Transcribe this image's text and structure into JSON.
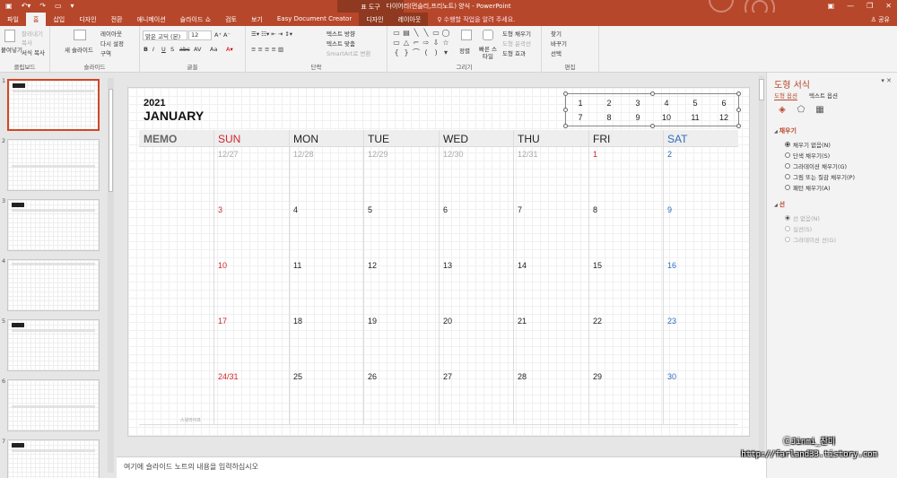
{
  "window": {
    "title": "다이어리(먼슬리,프리노트) 양식 - PowerPoint",
    "context_tab": "표 도구",
    "qat": [
      "save",
      "undo",
      "redo",
      "present"
    ]
  },
  "tabs": [
    {
      "label": "파일"
    },
    {
      "label": "홈",
      "active": true
    },
    {
      "label": "삽입"
    },
    {
      "label": "디자인"
    },
    {
      "label": "전환"
    },
    {
      "label": "애니메이션"
    },
    {
      "label": "슬라이드 쇼"
    },
    {
      "label": "검토"
    },
    {
      "label": "보기"
    },
    {
      "label": "Easy Document Creator"
    },
    {
      "label": "디자인",
      "contextual": true
    },
    {
      "label": "레이아웃"
    }
  ],
  "tell_me": "수행할 작업을 알려 주세요.",
  "share": "공유",
  "ribbon": {
    "clipboard": {
      "paste": "붙여넣기",
      "cut": "잘라내기",
      "copy": "복사",
      "format_painter": "서식 복사",
      "label": "클립보드"
    },
    "slides": {
      "new_slide": "새 슬라이드",
      "layout": "레이아웃",
      "reset": "다시 설정",
      "section": "구역",
      "label": "슬라이드"
    },
    "font": {
      "family": "맑은 고딕 (본)",
      "size": "12",
      "bold": "B",
      "italic": "I",
      "underline": "U",
      "shadow": "S",
      "strike": "abc",
      "spacing": "AV",
      "case": "Aa",
      "label": "글꼴"
    },
    "paragraph": {
      "text_direction": "텍스트 방향",
      "align_text": "텍스트 맞춤",
      "smartart": "SmartArt로 변환",
      "label": "단락"
    },
    "drawing": {
      "arrange": "정렬",
      "quick_styles": "빠른 스타일",
      "fill": "도형 채우기",
      "outline": "도형 윤곽선",
      "effects": "도형 효과",
      "label": "그리기"
    },
    "editing": {
      "find": "찾기",
      "replace": "바꾸기",
      "select": "선택",
      "label": "편집"
    }
  },
  "thumbnails": [
    {
      "num": "1",
      "selected": true,
      "type": "calendar"
    },
    {
      "num": "2",
      "type": "memo"
    },
    {
      "num": "3",
      "type": "calendar"
    },
    {
      "num": "4",
      "type": "memo"
    },
    {
      "num": "5",
      "type": "calendar"
    },
    {
      "num": "6",
      "type": "memo"
    },
    {
      "num": "7",
      "type": "calendar"
    }
  ],
  "slide": {
    "year": "2021",
    "month": "JANUARY",
    "mini_calendar": [
      [
        "1",
        "2",
        "3",
        "4",
        "5",
        "6"
      ],
      [
        "7",
        "8",
        "9",
        "10",
        "11",
        "12"
      ]
    ],
    "headers": [
      "MEMO",
      "SUN",
      "MON",
      "TUE",
      "WED",
      "THU",
      "FRI",
      "SAT"
    ],
    "weeks": [
      [
        "12/27",
        "12/28",
        "12/29",
        "12/30",
        "12/31",
        "1",
        "2"
      ],
      [
        "3",
        "4",
        "5",
        "6",
        "7",
        "8",
        "9"
      ],
      [
        "10",
        "11",
        "12",
        "13",
        "14",
        "15",
        "16"
      ],
      [
        "17",
        "18",
        "19",
        "20",
        "21",
        "22",
        "23"
      ],
      [
        "24/31",
        "25",
        "26",
        "27",
        "28",
        "29",
        "30"
      ]
    ],
    "signature": "스윗라이프"
  },
  "notes_placeholder": "여기에 슬라이드 노트의 내용을 입력하십시오",
  "format_pane": {
    "title": "도형 서식",
    "tab_shape": "도형 옵션",
    "tab_text": "텍스트 옵션",
    "fill_section": "채우기",
    "fill_options": [
      {
        "label": "채우기 없음(N)",
        "checked": true
      },
      {
        "label": "단색 채우기(S)"
      },
      {
        "label": "그라데이션 채우기(G)"
      },
      {
        "label": "그림 또는 질감 채우기(P)"
      },
      {
        "label": "패턴 채우기(A)"
      }
    ],
    "line_section": "선",
    "line_options": [
      {
        "label": "선 없음(N)",
        "checked": true
      },
      {
        "label": "실선(S)"
      },
      {
        "label": "그라데이션 선(G)"
      }
    ]
  },
  "watermark": {
    "line1": "ⓒJinmi_찬미",
    "line2": "http://farland33.tistory.com"
  },
  "colors": {
    "accent": "#b7472a",
    "sunday": "#d0262c",
    "saturday": "#2d6dbf"
  }
}
